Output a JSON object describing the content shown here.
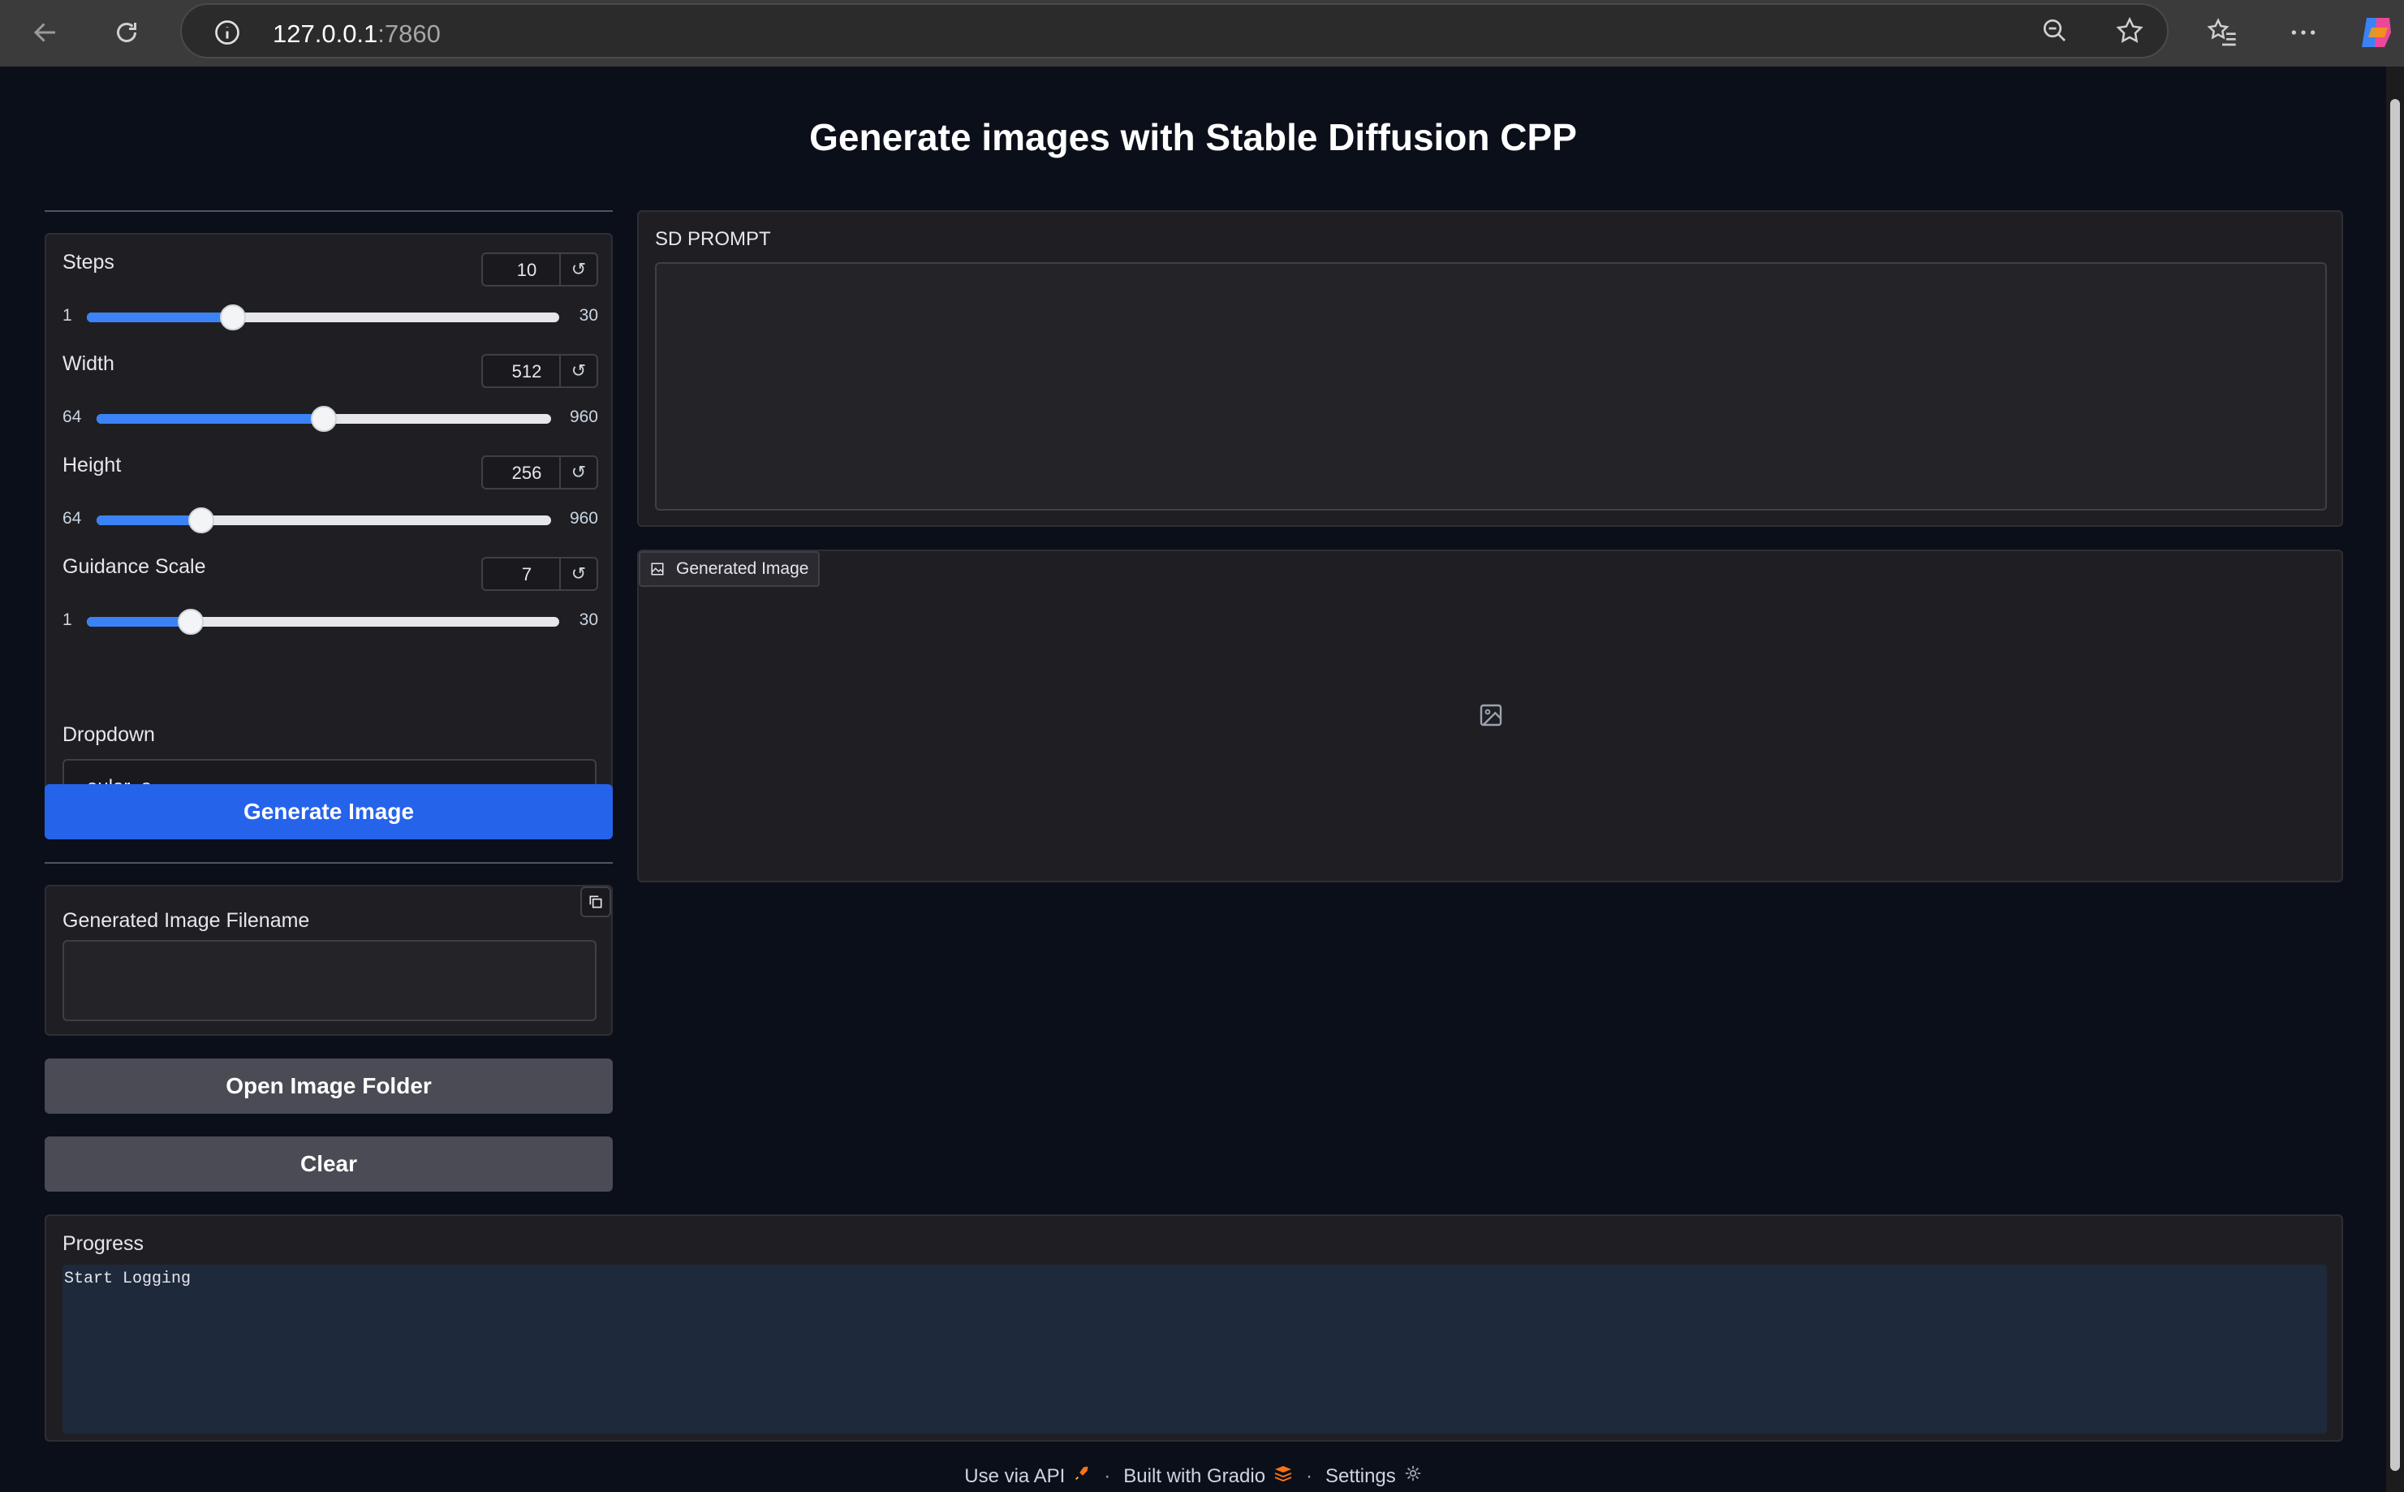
{
  "browser": {
    "url_host": "127.0.0.1",
    "url_port": ":7860",
    "icons": [
      "back-icon",
      "reload-icon",
      "info-icon",
      "zoom-out-icon",
      "favorite-star-icon",
      "favorites-list-icon",
      "more-icon",
      "copilot-icon"
    ]
  },
  "page": {
    "title": "Generate images with Stable Diffusion CPP"
  },
  "controls": {
    "steps": {
      "label": "Steps",
      "value": "10",
      "min": "1",
      "max": "30",
      "fraction": 0.31
    },
    "width": {
      "label": "Width",
      "value": "512",
      "min": "64",
      "max": "960",
      "fraction": 0.5
    },
    "height": {
      "label": "Height",
      "value": "256",
      "min": "64",
      "max": "960",
      "fraction": 0.23
    },
    "guidance": {
      "label": "Guidance Scale",
      "value": "7",
      "min": "1",
      "max": "30",
      "fraction": 0.22
    },
    "reset_symbol": "↺",
    "dropdown": {
      "label": "Dropdown",
      "value": "euler_a"
    }
  },
  "buttons": {
    "generate": "Generate Image",
    "open_folder": "Open Image Folder",
    "clear": "Clear"
  },
  "filename_field": {
    "label": "Generated Image Filename",
    "value": ""
  },
  "prompt": {
    "label": "SD PROMPT",
    "value": ""
  },
  "image_output": {
    "label": "Generated Image"
  },
  "progress": {
    "label": "Progress",
    "log": "Start Logging"
  },
  "footer": {
    "api": "Use via API",
    "built": "Built with Gradio",
    "settings": "Settings",
    "dot": "·"
  },
  "colors": {
    "accent": "#2563eb",
    "background": "#0b0f19",
    "panel": "#1f2937"
  }
}
